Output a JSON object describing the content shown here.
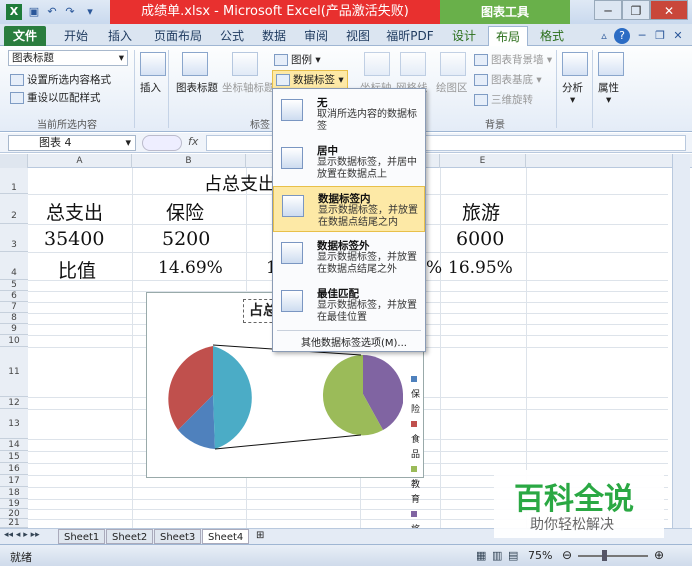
{
  "window": {
    "title": "成绩单.xlsx - Microsoft Excel(产品激活失败)",
    "chart_tools": "图表工具"
  },
  "tabs": [
    "文件",
    "开始",
    "插入",
    "页面布局",
    "公式",
    "数据",
    "审阅",
    "视图",
    "福昕PDF",
    "设计",
    "布局",
    "格式"
  ],
  "ribbon": {
    "selection": "图表标题",
    "format_selection": "设置所选内容格式",
    "reset_style": "重设以匹配样式",
    "current_selection_group": "当前所选内容",
    "insert": "插入",
    "chart_title": "图表标题",
    "axis_title": "坐标轴标题",
    "legend": "图例",
    "data_labels": "数据标签",
    "labels_group": "标签",
    "axes": "坐标轴",
    "gridlines": "网格线",
    "plot_area": "绘图区",
    "chart_wall": "图表背景墙",
    "chart_floor": "图表基底",
    "rotation_3d": "三维旋转",
    "background_group": "背景",
    "analysis": "分析",
    "properties": "属性"
  },
  "formula_bar": {
    "name_box": "图表 4",
    "fx": "fx"
  },
  "columns": [
    "A",
    "B",
    "C",
    "D",
    "E"
  ],
  "rows": [
    "1",
    "2",
    "3",
    "4",
    "5",
    "6",
    "7",
    "8",
    "9",
    "10",
    "11",
    "12",
    "13",
    "14",
    "15",
    "16",
    "17",
    "18",
    "19",
    "20",
    "21"
  ],
  "cells": {
    "title": "占总支出",
    "r2": [
      "总支出",
      "保险",
      "旅游"
    ],
    "r3": [
      "35400",
      "5200",
      "6000"
    ],
    "r4": [
      "比值",
      "14.69%",
      "16.95%"
    ],
    "r4_partial_c": "1",
    "r4_partial_d": "%"
  },
  "chart": {
    "title": "占总",
    "legend": [
      "保险",
      "食品",
      "教育",
      "旅游"
    ],
    "colors": [
      "#4f81bd",
      "#c0504d",
      "#9bbb59",
      "#8064a2",
      "#4bacc6"
    ]
  },
  "dropdown": {
    "items": [
      {
        "title": "无",
        "desc": "取消所选内容的数据标签"
      },
      {
        "title": "居中",
        "desc": "显示数据标签，并居中放置在数据点上"
      },
      {
        "title": "数据标签内",
        "desc": "显示数据标签，并放置在数据点结尾之内"
      },
      {
        "title": "数据标签外",
        "desc": "显示数据标签，并放置在数据点结尾之外"
      },
      {
        "title": "最佳匹配",
        "desc": "显示数据标签，并放置在最佳位置"
      }
    ],
    "more": "其他数据标签选项(M)..."
  },
  "sheets": [
    "Sheet1",
    "Sheet2",
    "Sheet3",
    "Sheet4"
  ],
  "status": {
    "ready": "就绪",
    "zoom": "75%"
  },
  "watermark": {
    "main": "百科全说",
    "sub": "助你轻松解决"
  }
}
